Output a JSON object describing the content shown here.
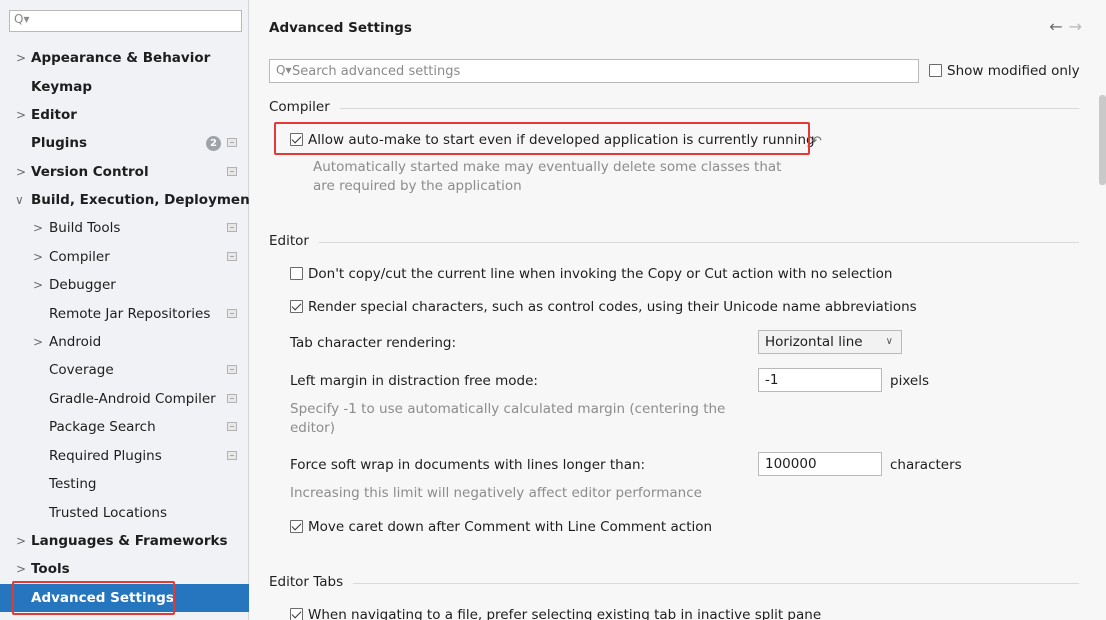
{
  "sidebar": {
    "search_placeholder": "",
    "items": [
      {
        "label": "Appearance & Behavior"
      },
      {
        "label": "Keymap"
      },
      {
        "label": "Editor"
      },
      {
        "label": "Plugins",
        "badge": "2"
      },
      {
        "label": "Version Control"
      },
      {
        "label": "Build, Execution, Deployment"
      },
      {
        "label": "Build Tools"
      },
      {
        "label": "Compiler"
      },
      {
        "label": "Debugger"
      },
      {
        "label": "Remote Jar Repositories"
      },
      {
        "label": "Android"
      },
      {
        "label": "Coverage"
      },
      {
        "label": "Gradle-Android Compiler"
      },
      {
        "label": "Package Search"
      },
      {
        "label": "Required Plugins"
      },
      {
        "label": "Testing"
      },
      {
        "label": "Trusted Locations"
      },
      {
        "label": "Languages & Frameworks"
      },
      {
        "label": "Tools"
      },
      {
        "label": "Advanced Settings"
      }
    ]
  },
  "main": {
    "title": "Advanced Settings",
    "search_placeholder": "Search advanced settings",
    "show_modified_label": "Show modified only",
    "compiler": {
      "title": "Compiler",
      "auto_make_label": "Allow auto-make to start even if developed application is currently running",
      "auto_make_hint_1": "Automatically started make may eventually delete some classes that",
      "auto_make_hint_2": "are required by the application"
    },
    "editor": {
      "title": "Editor",
      "copy_cut_label": "Don't copy/cut the current line when invoking the Copy or Cut action with no selection",
      "render_special_label": "Render special characters, such as control codes, using their Unicode name abbreviations",
      "tab_rendering_label": "Tab character rendering:",
      "tab_rendering_value": "Horizontal line",
      "left_margin_label": "Left margin in distraction free mode:",
      "left_margin_value": "-1",
      "left_margin_unit": "pixels",
      "left_margin_hint_1": "Specify -1 to use automatically calculated margin (centering the",
      "left_margin_hint_2": "editor)",
      "soft_wrap_label": "Force soft wrap in documents with lines longer than:",
      "soft_wrap_value": "100000",
      "soft_wrap_unit": "characters",
      "soft_wrap_hint": "Increasing this limit will negatively affect editor performance",
      "move_caret_label": "Move caret down after Comment with Line Comment action"
    },
    "editor_tabs": {
      "title": "Editor Tabs",
      "prefer_existing_label": "When navigating to a file, prefer selecting existing tab in inactive split pane"
    }
  },
  "colors": {
    "selection": "#2675bf",
    "highlight_box": "#e53935"
  }
}
